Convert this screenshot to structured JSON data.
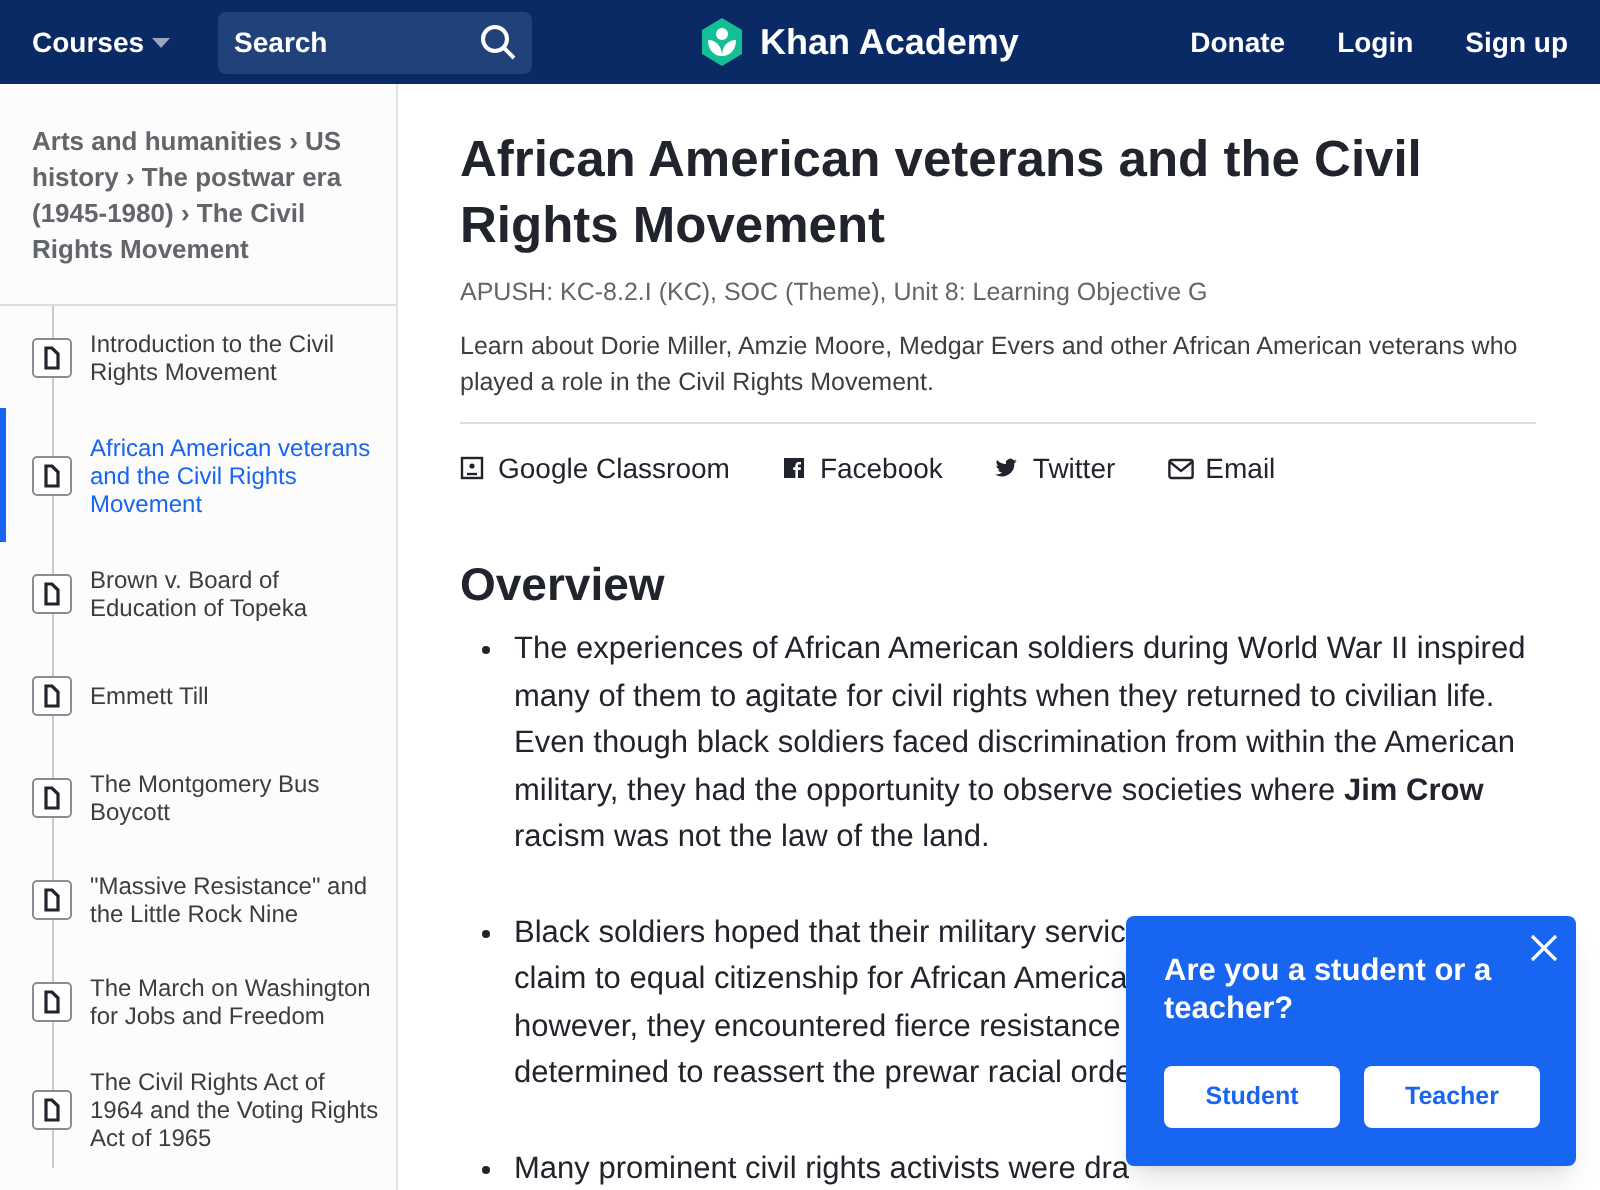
{
  "header": {
    "courses": "Courses",
    "search": {
      "placeholder": "Search"
    },
    "logo": "Khan Academy",
    "links": [
      "Donate",
      "Login",
      "Sign up"
    ]
  },
  "breadcrumb": {
    "separator": "›",
    "items": [
      "Arts and humanities",
      "US history",
      "The postwar era (1945-1980)",
      "The Civil Rights Movement"
    ]
  },
  "sidebar_items": [
    {
      "label": "Introduction to the Civil Rights Movement",
      "selected": false
    },
    {
      "label": "African American veterans and the Civil Rights Movement",
      "selected": true
    },
    {
      "label": "Brown v. Board of Education of Topeka",
      "selected": false
    },
    {
      "label": "Emmett Till",
      "selected": false
    },
    {
      "label": "The Montgomery Bus Boycott",
      "selected": false
    },
    {
      "label": "\"Massive Resistance\" and the Little Rock Nine",
      "selected": false
    },
    {
      "label": "The March on Washington for Jobs and Freedom",
      "selected": false
    },
    {
      "label": "The Civil Rights Act of 1964 and the Voting Rights Act of 1965",
      "selected": false
    }
  ],
  "article": {
    "title": "African American veterans and the Civil Rights Movement",
    "standards": "APUSH: KC-8.2.I (KC), SOC (Theme), Unit 8: Learning Objective G",
    "description": "Learn about Dorie Miller, Amzie Moore, Medgar Evers and other African American veterans who played a role in the Civil Rights Movement.",
    "share": [
      {
        "kind": "classroom",
        "label": "Google Classroom"
      },
      {
        "kind": "facebook",
        "label": "Facebook"
      },
      {
        "kind": "twitter",
        "label": "Twitter"
      },
      {
        "kind": "email",
        "label": "Email"
      }
    ],
    "heading": "Overview",
    "bullets": [
      {
        "lines": [
          "The experiences of African American soldiers during World War II inspired",
          "many of them to agitate for civil rights when they returned to civilian life.",
          "Even though black soldiers faced discrimination from within the American",
          "military, they had the opportunity to observe societies where **Jim Crow**",
          "racism was not the law of the land."
        ]
      },
      {
        "lines": [
          "Black soldiers hoped that their military servic",
          "claim to equal citizenship for African America",
          "however, they encountered fierce resistance",
          "determined to reassert the prewar racial orde"
        ]
      },
      {
        "lines": [
          "Many prominent civil rights activists were dra"
        ]
      }
    ]
  },
  "popup": {
    "question": "Are you a student or a teacher?",
    "buttons": [
      "Student",
      "Teacher"
    ]
  }
}
